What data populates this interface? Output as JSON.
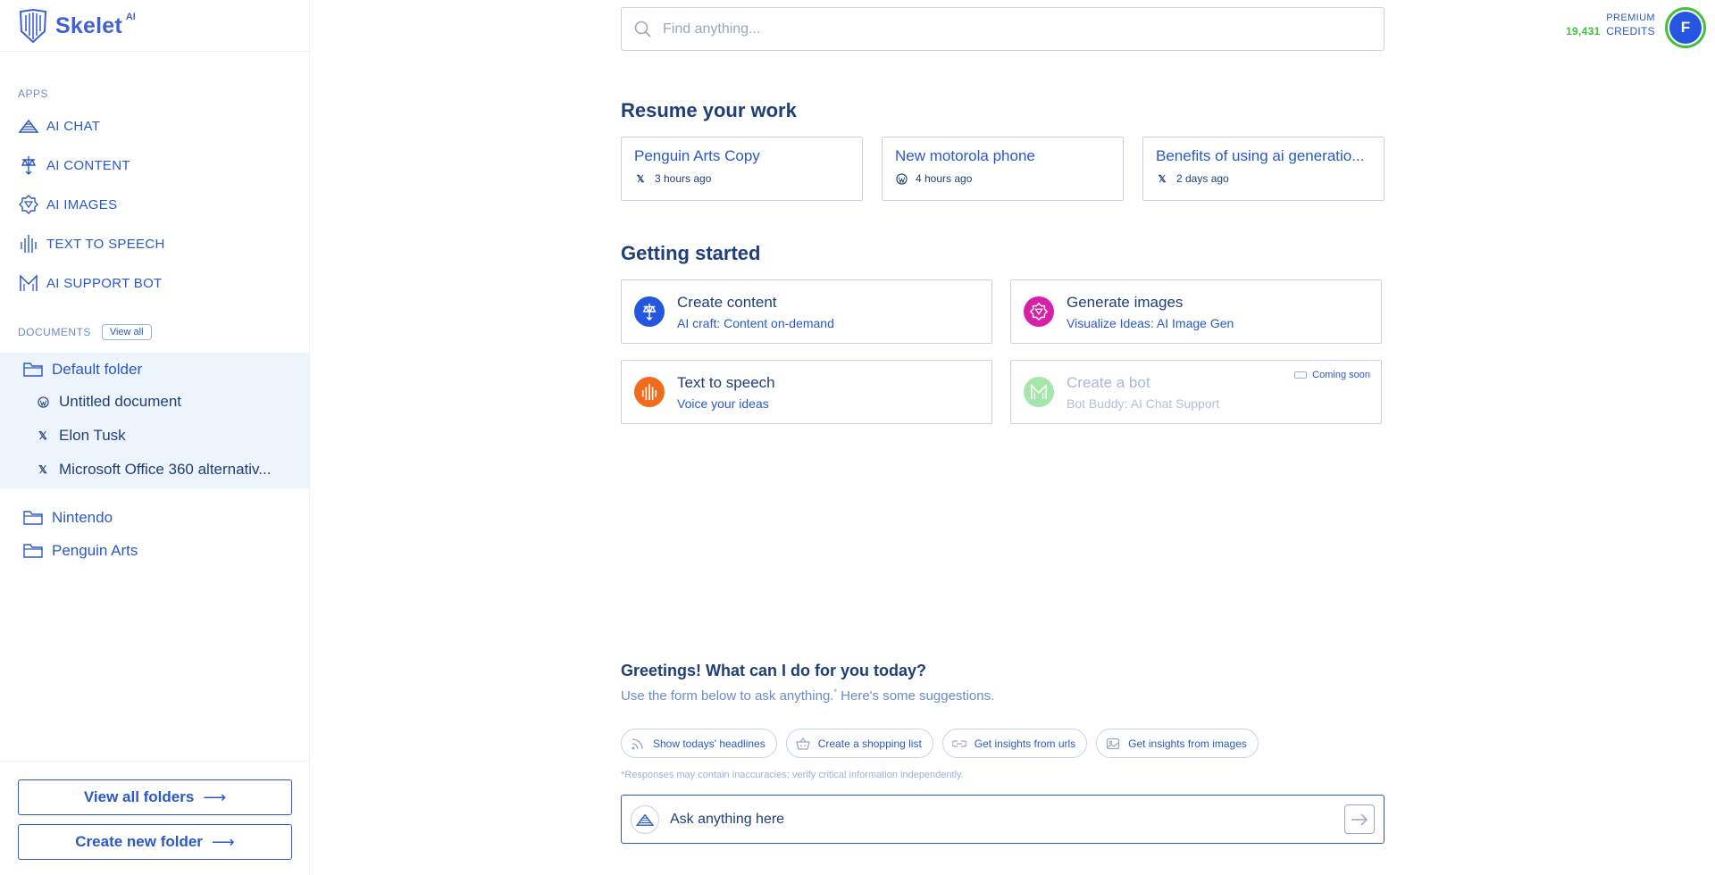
{
  "brand": {
    "name": "Skelet",
    "sup": "AI"
  },
  "sidebar": {
    "apps_label": "APPS",
    "apps": [
      {
        "label": "AI CHAT",
        "icon": "ai-chat-icon"
      },
      {
        "label": "AI CONTENT",
        "icon": "ai-content-icon"
      },
      {
        "label": "AI IMAGES",
        "icon": "ai-images-icon"
      },
      {
        "label": "TEXT TO SPEECH",
        "icon": "text-to-speech-icon"
      },
      {
        "label": "AI SUPPORT BOT",
        "icon": "ai-support-bot-icon"
      }
    ],
    "documents_label": "DOCUMENTS",
    "view_all_label": "View all",
    "folders": [
      {
        "name": "Default folder",
        "expanded": true,
        "documents": [
          {
            "name": "Untitled document",
            "icon": "wordpress-icon"
          },
          {
            "name": "Elon Tusk",
            "icon": "x-icon"
          },
          {
            "name": "Microsoft Office 360 alternativ...",
            "icon": "x-icon"
          }
        ]
      },
      {
        "name": "Nintendo",
        "expanded": false
      },
      {
        "name": "Penguin Arts",
        "expanded": false
      }
    ],
    "view_all_folders_label": "View all folders",
    "create_folder_label": "Create new folder"
  },
  "account": {
    "tier": "PREMIUM",
    "credits_value": "19,431",
    "credits_label": "CREDITS",
    "avatar_initial": "F"
  },
  "search": {
    "placeholder": "Find anything..."
  },
  "resume": {
    "title": "Resume your work",
    "items": [
      {
        "title": "Penguin Arts Copy",
        "icon": "x-icon",
        "time": "3 hours ago"
      },
      {
        "title": "New motorola phone",
        "icon": "wordpress-icon",
        "time": "4 hours ago"
      },
      {
        "title": "Benefits of using ai generatio...",
        "icon": "x-icon",
        "time": "2 days ago"
      }
    ]
  },
  "getting_started": {
    "title": "Getting started",
    "items": [
      {
        "title": "Create content",
        "subtitle": "AI craft: Content on-demand",
        "icon": "create-content-icon",
        "color": "#2456e0"
      },
      {
        "title": "Generate images",
        "subtitle": "Visualize Ideas: AI Image Gen",
        "icon": "generate-images-icon",
        "color": "#d81fa8"
      },
      {
        "title": "Text to speech",
        "subtitle": "Voice your ideas",
        "icon": "text-to-speech-icon",
        "color": "#f26a1b"
      },
      {
        "title": "Create a bot",
        "subtitle": "Bot Buddy: AI Chat Support",
        "icon": "create-bot-icon",
        "color": "#a6e6ad",
        "badge": "Coming soon"
      }
    ]
  },
  "chat": {
    "greeting": "Greetings! What can I do for you today?",
    "subtitle": "Use the form below to ask anything.",
    "subtitle_mark": "*",
    "subtitle_end": " Here's some suggestions.",
    "suggestions": [
      {
        "label": "Show todays' headlines",
        "icon": "rss-icon"
      },
      {
        "label": "Create a shopping list",
        "icon": "basket-icon"
      },
      {
        "label": "Get insights from urls",
        "icon": "link-icon"
      },
      {
        "label": "Get insights from images",
        "icon": "image-icon"
      }
    ],
    "disclaimer": "*Responses may contain inaccuracies; verify critical information independently.",
    "placeholder": "Ask anything here"
  },
  "colors": {
    "primary": "#2a58c9",
    "navy": "#1f3f7a",
    "credits_green": "#42c23a"
  }
}
